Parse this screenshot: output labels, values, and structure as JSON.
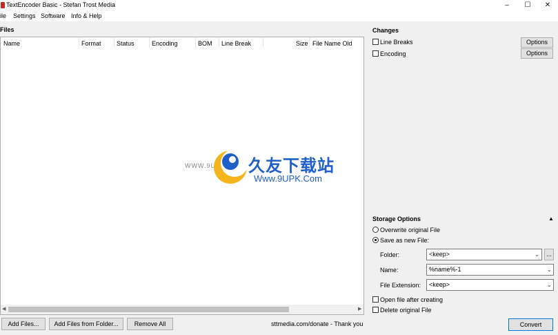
{
  "window": {
    "title": "TextEncoder Basic - Stefan Trost Media",
    "minimize_glyph": "–",
    "maximize_glyph": "☐",
    "close_glyph": "✕"
  },
  "menu": {
    "file": "ile",
    "settings": "Settings",
    "software": "Software",
    "info": "Info & Help"
  },
  "files": {
    "title": "Files",
    "columns": [
      "Name",
      "Format",
      "Status",
      "Encoding",
      "BOM",
      "Line Break",
      "Size",
      "File Name Old"
    ],
    "rows": []
  },
  "buttons": {
    "add_files": "Add Files...",
    "add_from_folder": "Add Files from Folder...",
    "remove_all": "Remove All",
    "convert": "Convert",
    "options": "Options",
    "browse": "..."
  },
  "status": "sttmedia.com/donate - Thank you",
  "changes": {
    "title": "Changes",
    "line_breaks": {
      "label": "Line Breaks",
      "checked": false
    },
    "encoding": {
      "label": "Encoding",
      "checked": false
    }
  },
  "storage": {
    "title": "Storage Options",
    "collapse_glyph": "▲",
    "overwrite": {
      "label": "Overwrite original File",
      "selected": false
    },
    "save_new": {
      "label": "Save as new File:",
      "selected": true
    },
    "folder": {
      "label": "Folder:",
      "value": "<keep>"
    },
    "name": {
      "label": "Name:",
      "value": "%name%-1"
    },
    "extension": {
      "label": "File Extension:",
      "value": "<keep>"
    },
    "open_after": {
      "label": "Open file after creating",
      "checked": false
    },
    "delete_original": {
      "label": "Delete original File",
      "checked": false
    }
  },
  "watermark": {
    "url_left": "WWW.9UPK.COM",
    "brand": "久友下载站",
    "url": "Www.9UPK.Com"
  },
  "colors": {
    "watermark_blue": "#1f5fc8",
    "close_red": "#c42b1c"
  }
}
